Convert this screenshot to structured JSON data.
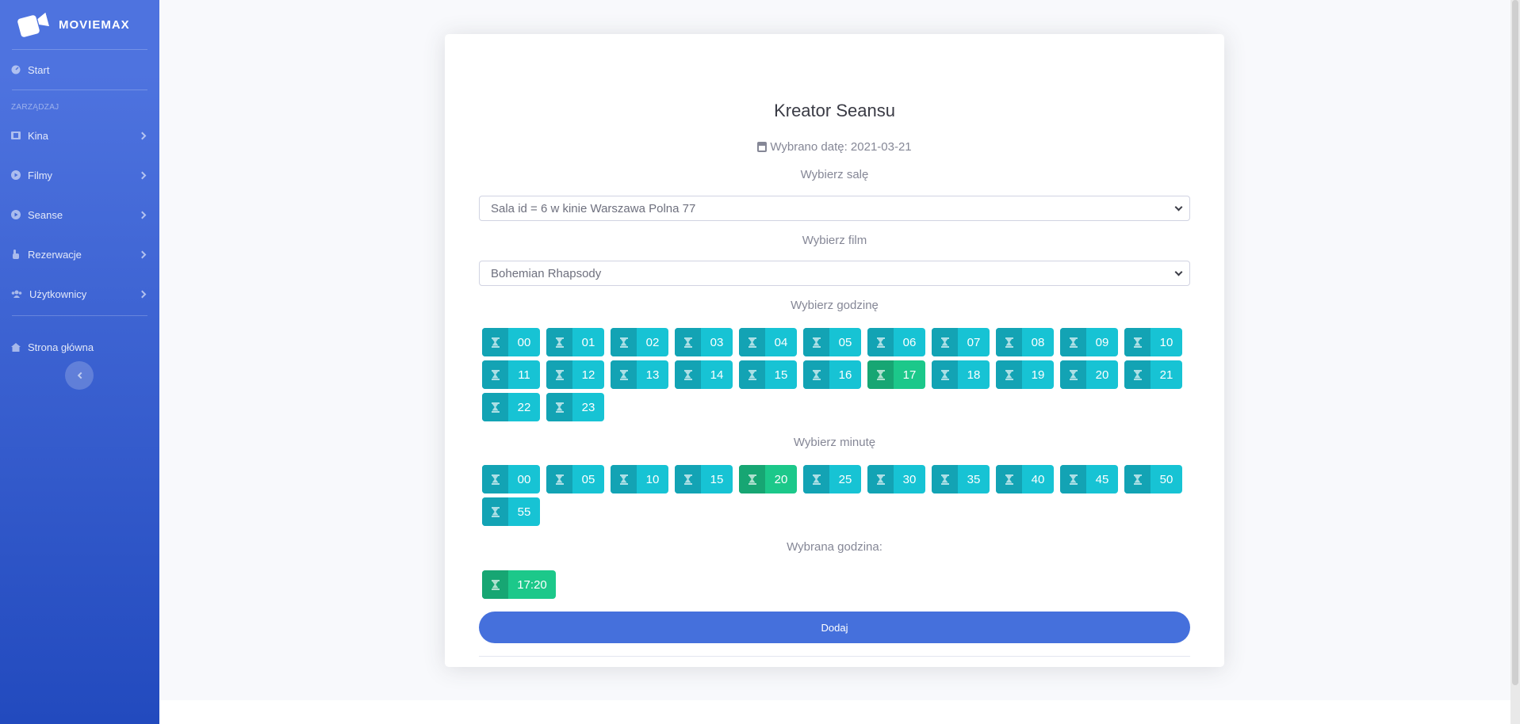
{
  "sidebar": {
    "brand": "MOVIEMAX",
    "start": "Start",
    "heading": "ZARZĄDZAJ",
    "items": [
      {
        "label": "Kina",
        "icon": "film-icon"
      },
      {
        "label": "Filmy",
        "icon": "play-circle-icon"
      },
      {
        "label": "Seanse",
        "icon": "play-circle-icon"
      },
      {
        "label": "Rezerwacje",
        "icon": "hand-pointer-icon"
      },
      {
        "label": "Użytkownicy",
        "icon": "users-icon"
      }
    ],
    "home": "Strona główna"
  },
  "form": {
    "title": "Kreator Seansu",
    "date_label": "Wybrano datę: 2021-03-21",
    "hall_label": "Wybierz salę",
    "hall_value": "Sala id = 6 w kinie Warszawa Polna 77",
    "film_label": "Wybierz film",
    "film_value": "Bohemian Rhapsody",
    "hour_label": "Wybierz godzinę",
    "hours": [
      "00",
      "01",
      "02",
      "03",
      "04",
      "05",
      "06",
      "07",
      "08",
      "09",
      "10",
      "11",
      "12",
      "13",
      "14",
      "15",
      "16",
      "17",
      "18",
      "19",
      "20",
      "21",
      "22",
      "23"
    ],
    "selected_hour": "17",
    "minute_label": "Wybierz minutę",
    "minutes": [
      "00",
      "05",
      "10",
      "15",
      "20",
      "25",
      "30",
      "35",
      "40",
      "45",
      "50",
      "55"
    ],
    "selected_minute": "20",
    "chosen_label": "Wybrana godzina:",
    "chosen_value": "17:20",
    "submit": "Dodaj"
  },
  "colors": {
    "sidebar_top": "#4e73df",
    "sidebar_bottom": "#224abe",
    "time_button": "#17c3d4",
    "time_button_selected": "#1cc88a",
    "primary": "#4570dc"
  }
}
